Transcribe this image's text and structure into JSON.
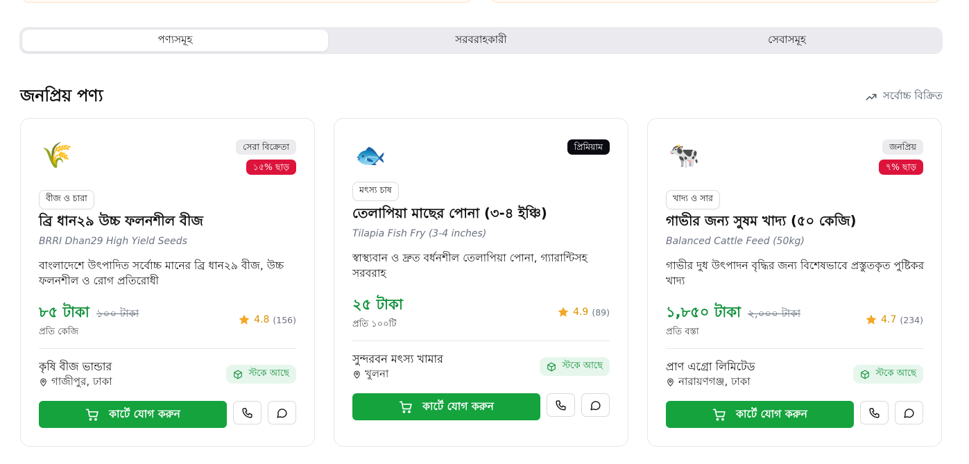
{
  "tabs": [
    {
      "label": "পণ্যসমূহ",
      "active": true
    },
    {
      "label": "সরবরাহকারী",
      "active": false
    },
    {
      "label": "সেবাসমূহ",
      "active": false
    }
  ],
  "section": {
    "title": "জনপ্রিয় পণ্য",
    "link_label": "সর্বোচ্চ বিক্রিত",
    "link_icon": "trending-up-icon"
  },
  "colors": {
    "accent_green": "#14a33d",
    "price_green": "#11913a",
    "discount_red": "#dc143c",
    "star": "#f5a623"
  },
  "products": [
    {
      "emoji": "🌾",
      "icon": "rice-plant-icon",
      "badges": [
        "সেরা বিক্রেতা",
        "১৫% ছাড়"
      ],
      "category": "বীজ ও চারা",
      "name_bn": "ব্রি ধান২৯ উচ্চ ফলনশীল বীজ",
      "name_en": "BRRI Dhan29 High Yield Seeds",
      "description": "বাংলাদেশে উৎপাদিত সর্বোচ্চ মানের ব্রি ধান২৯ বীজ, উচ্চ ফলনশীল ও রোগ প্রতিরোধী",
      "price": "৮৫ টাকা",
      "old_price": "১০০ টাকা",
      "unit": "প্রতি কেজি",
      "rating": "4.8",
      "reviews": "(156)",
      "seller": "কৃষি বীজ ভান্ডার",
      "location": "গাজীপুর, ঢাকা",
      "stock": "স্টকে আছে",
      "cart_label": "কার্টে যোগ করুন"
    },
    {
      "emoji": "🐟",
      "icon": "fish-icon",
      "badges": [
        "প্রিমিয়াম"
      ],
      "category": "মৎস্য চাষ",
      "name_bn": "তেলাপিয়া মাছের পোনা (৩-৪ ইঞ্চি)",
      "name_en": "Tilapia Fish Fry (3-4 inches)",
      "description": "স্বাস্থ্যবান ও দ্রুত বর্ধনশীল তেলাপিয়া পোনা, গ্যারান্টিসহ সরবরাহ",
      "price": "২৫ টাকা",
      "old_price": "",
      "unit": "প্রতি ১০০টি",
      "rating": "4.9",
      "reviews": "(89)",
      "seller": "সুন্দরবন মৎস্য খামার",
      "location": "খুলনা",
      "stock": "স্টকে আছে",
      "cart_label": "কার্টে যোগ করুন"
    },
    {
      "emoji": "🐄",
      "icon": "cow-icon",
      "badges": [
        "জনপ্রিয়",
        "৭% ছাড়"
      ],
      "category": "খাদ্য ও সার",
      "name_bn": "গাভীর জন্য সুষম খাদ্য (৫০ কেজি)",
      "name_en": "Balanced Cattle Feed (50kg)",
      "description": "গাভীর দুধ উৎপাদন বৃদ্ধির জন্য বিশেষভাবে প্রস্তুতকৃত পুষ্টিকর খাদ্য",
      "price": "১,৮৫০ টাকা",
      "old_price": "২,০০০ টাকা",
      "unit": "প্রতি বস্তা",
      "rating": "4.7",
      "reviews": "(234)",
      "seller": "প্রাণ এগ্রো লিমিটেড",
      "location": "নারায়ণগঞ্জ, ঢাকা",
      "stock": "স্টকে আছে",
      "cart_label": "কার্টে যোগ করুন"
    }
  ]
}
